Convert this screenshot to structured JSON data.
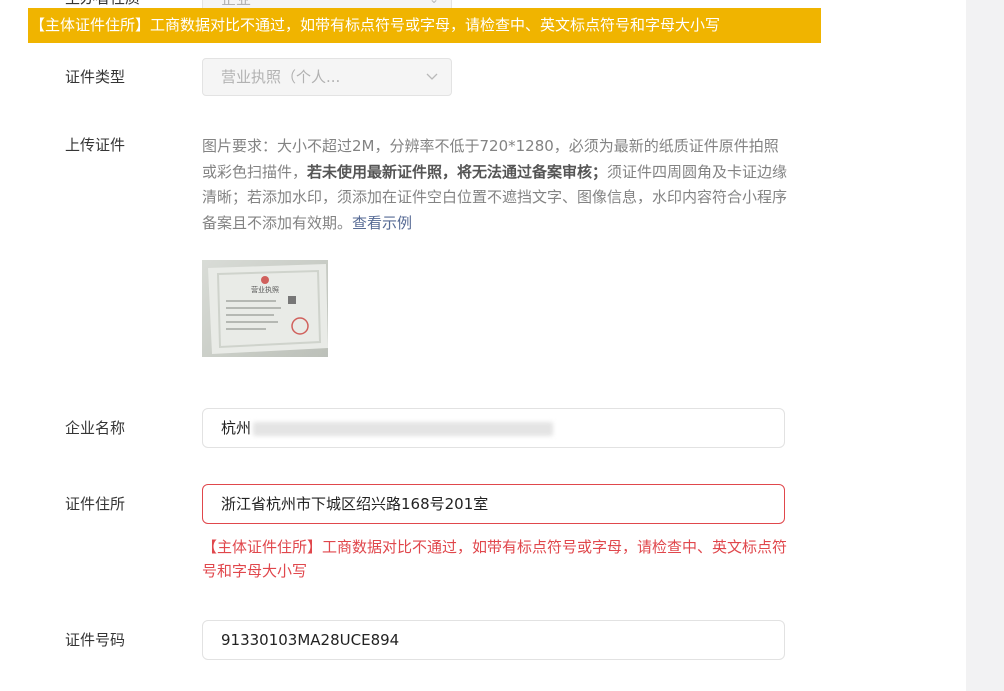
{
  "banner": {
    "text": "【主体证件住所】工商数据对比不通过，如带有标点符号或字母，请检查中、英文标点符号和字母大小写"
  },
  "top_row": {
    "label": "主办者性质",
    "value": "企业"
  },
  "cert_type": {
    "label": "证件类型",
    "value": "营业执照（个人...",
    "chevron": "chevron-down-icon"
  },
  "upload": {
    "label": "上传证件",
    "desc_part1": "图片要求：大小不超过2M，分辨率不低于720*1280，必须为最新的纸质证件原件拍照或彩色扫描件，",
    "desc_bold": "若未使用最新证件照，将无法通过备案审核；",
    "desc_part2": "须证件四周圆角及卡证边缘清晰；若添加水印，须添加在证件空白位置不遮挡文字、图像信息，水印内容符合小程序备案且不添加有效期。",
    "example_link": "查看示例",
    "thumb_title": "营业执照"
  },
  "company": {
    "label": "企业名称",
    "value_prefix": "杭州"
  },
  "address": {
    "label": "证件住所",
    "value": "浙江省杭州市下城区绍兴路168号201室",
    "error": "【主体证件住所】工商数据对比不通过，如带有标点符号或字母，请检查中、英文标点符号和字母大小写"
  },
  "cert_no": {
    "label": "证件号码",
    "value": "91330103MA28UCE894"
  },
  "colors": {
    "banner_bg": "#f0b400",
    "error": "#e0474c",
    "link": "#576b95"
  }
}
